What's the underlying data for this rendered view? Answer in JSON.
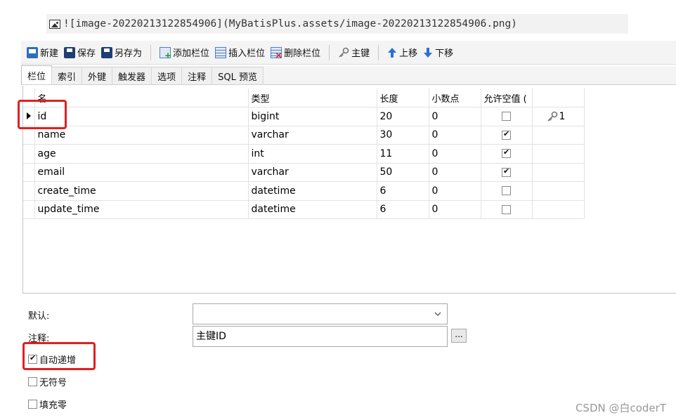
{
  "markdown_line": "![image-20220213122854906](MyBatisPlus.assets/image-20220213122854906.png)",
  "toolbar": {
    "new": "新建",
    "save": "保存",
    "save_as": "另存为",
    "add_column": "添加栏位",
    "insert_column": "插入栏位",
    "delete_column": "删除栏位",
    "primary_key": "主键",
    "move_up": "上移",
    "move_down": "下移"
  },
  "tabs": [
    "栏位",
    "索引",
    "外键",
    "触发器",
    "选项",
    "注释",
    "SQL 预览"
  ],
  "grid": {
    "headers": [
      "名",
      "类型",
      "长度",
      "小数点",
      "允许空值 ("
    ],
    "rows": [
      {
        "name": "id",
        "type": "bigint",
        "length": "20",
        "decimals": "0",
        "nullable": false,
        "key": "1"
      },
      {
        "name": "name",
        "type": "varchar",
        "length": "30",
        "decimals": "0",
        "nullable": true,
        "key": ""
      },
      {
        "name": "age",
        "type": "int",
        "length": "11",
        "decimals": "0",
        "nullable": true,
        "key": ""
      },
      {
        "name": "email",
        "type": "varchar",
        "length": "50",
        "decimals": "0",
        "nullable": true,
        "key": ""
      },
      {
        "name": "create_time",
        "type": "datetime",
        "length": "6",
        "decimals": "0",
        "nullable": false,
        "key": ""
      },
      {
        "name": "update_time",
        "type": "datetime",
        "length": "6",
        "decimals": "0",
        "nullable": false,
        "key": ""
      }
    ]
  },
  "properties": {
    "default_label": "默认:",
    "default_value": "",
    "comment_label": "注释:",
    "comment_value": "主键ID",
    "dots_button": "...",
    "auto_increment_label": "自动递增",
    "auto_increment": true,
    "unsigned_label": "无符号",
    "unsigned": false,
    "zerofill_label": "填充零",
    "zerofill": false
  },
  "watermark": "CSDN @白coderT",
  "colors": {
    "highlight": "#e02020",
    "toolbar_bg": "#f4f4f4"
  }
}
